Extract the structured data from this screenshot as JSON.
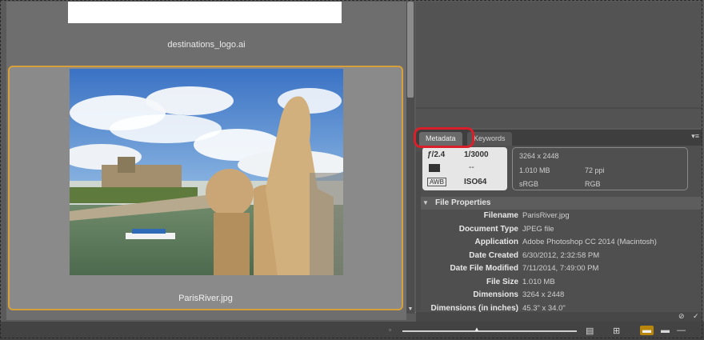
{
  "content": {
    "items": [
      {
        "filename": "destinations_logo.ai",
        "selected": false
      },
      {
        "filename": "ParisRiver.jpg",
        "selected": true
      }
    ]
  },
  "metadata_panel": {
    "tabs": [
      {
        "label": "Metadata",
        "active": true
      },
      {
        "label": "Keywords",
        "active": false
      }
    ],
    "exif": {
      "aperture": "ƒ/2.4",
      "shutter": "1/3000",
      "exposure_comp": "--",
      "iso": "ISO64",
      "awb": "AWB"
    },
    "info": {
      "dimensions": "3264 x 2448",
      "file_size": "1.010 MB",
      "resolution": "72 ppi",
      "color_profile": "sRGB",
      "color_mode": "RGB"
    },
    "section_title": "File Properties",
    "properties": [
      {
        "label": "Filename",
        "value": "ParisRiver.jpg"
      },
      {
        "label": "Document Type",
        "value": "JPEG file"
      },
      {
        "label": "Application",
        "value": "Adobe Photoshop CC 2014 (Macintosh)"
      },
      {
        "label": "Date Created",
        "value": "6/30/2012, 2:32:58 PM"
      },
      {
        "label": "Date File Modified",
        "value": "7/11/2014, 7:49:00 PM"
      },
      {
        "label": "File Size",
        "value": "1.010 MB"
      },
      {
        "label": "Dimensions",
        "value": "3264 x 2448"
      },
      {
        "label": "Dimensions (in inches)",
        "value": "45.3\" x 34.0\""
      }
    ]
  },
  "colors": {
    "selection_border": "#d8a03a",
    "highlight_ring": "#d9202a",
    "panel_bg": "#4f4f4f"
  },
  "statusbar": {
    "thumbnail_size_level": 0.41
  }
}
